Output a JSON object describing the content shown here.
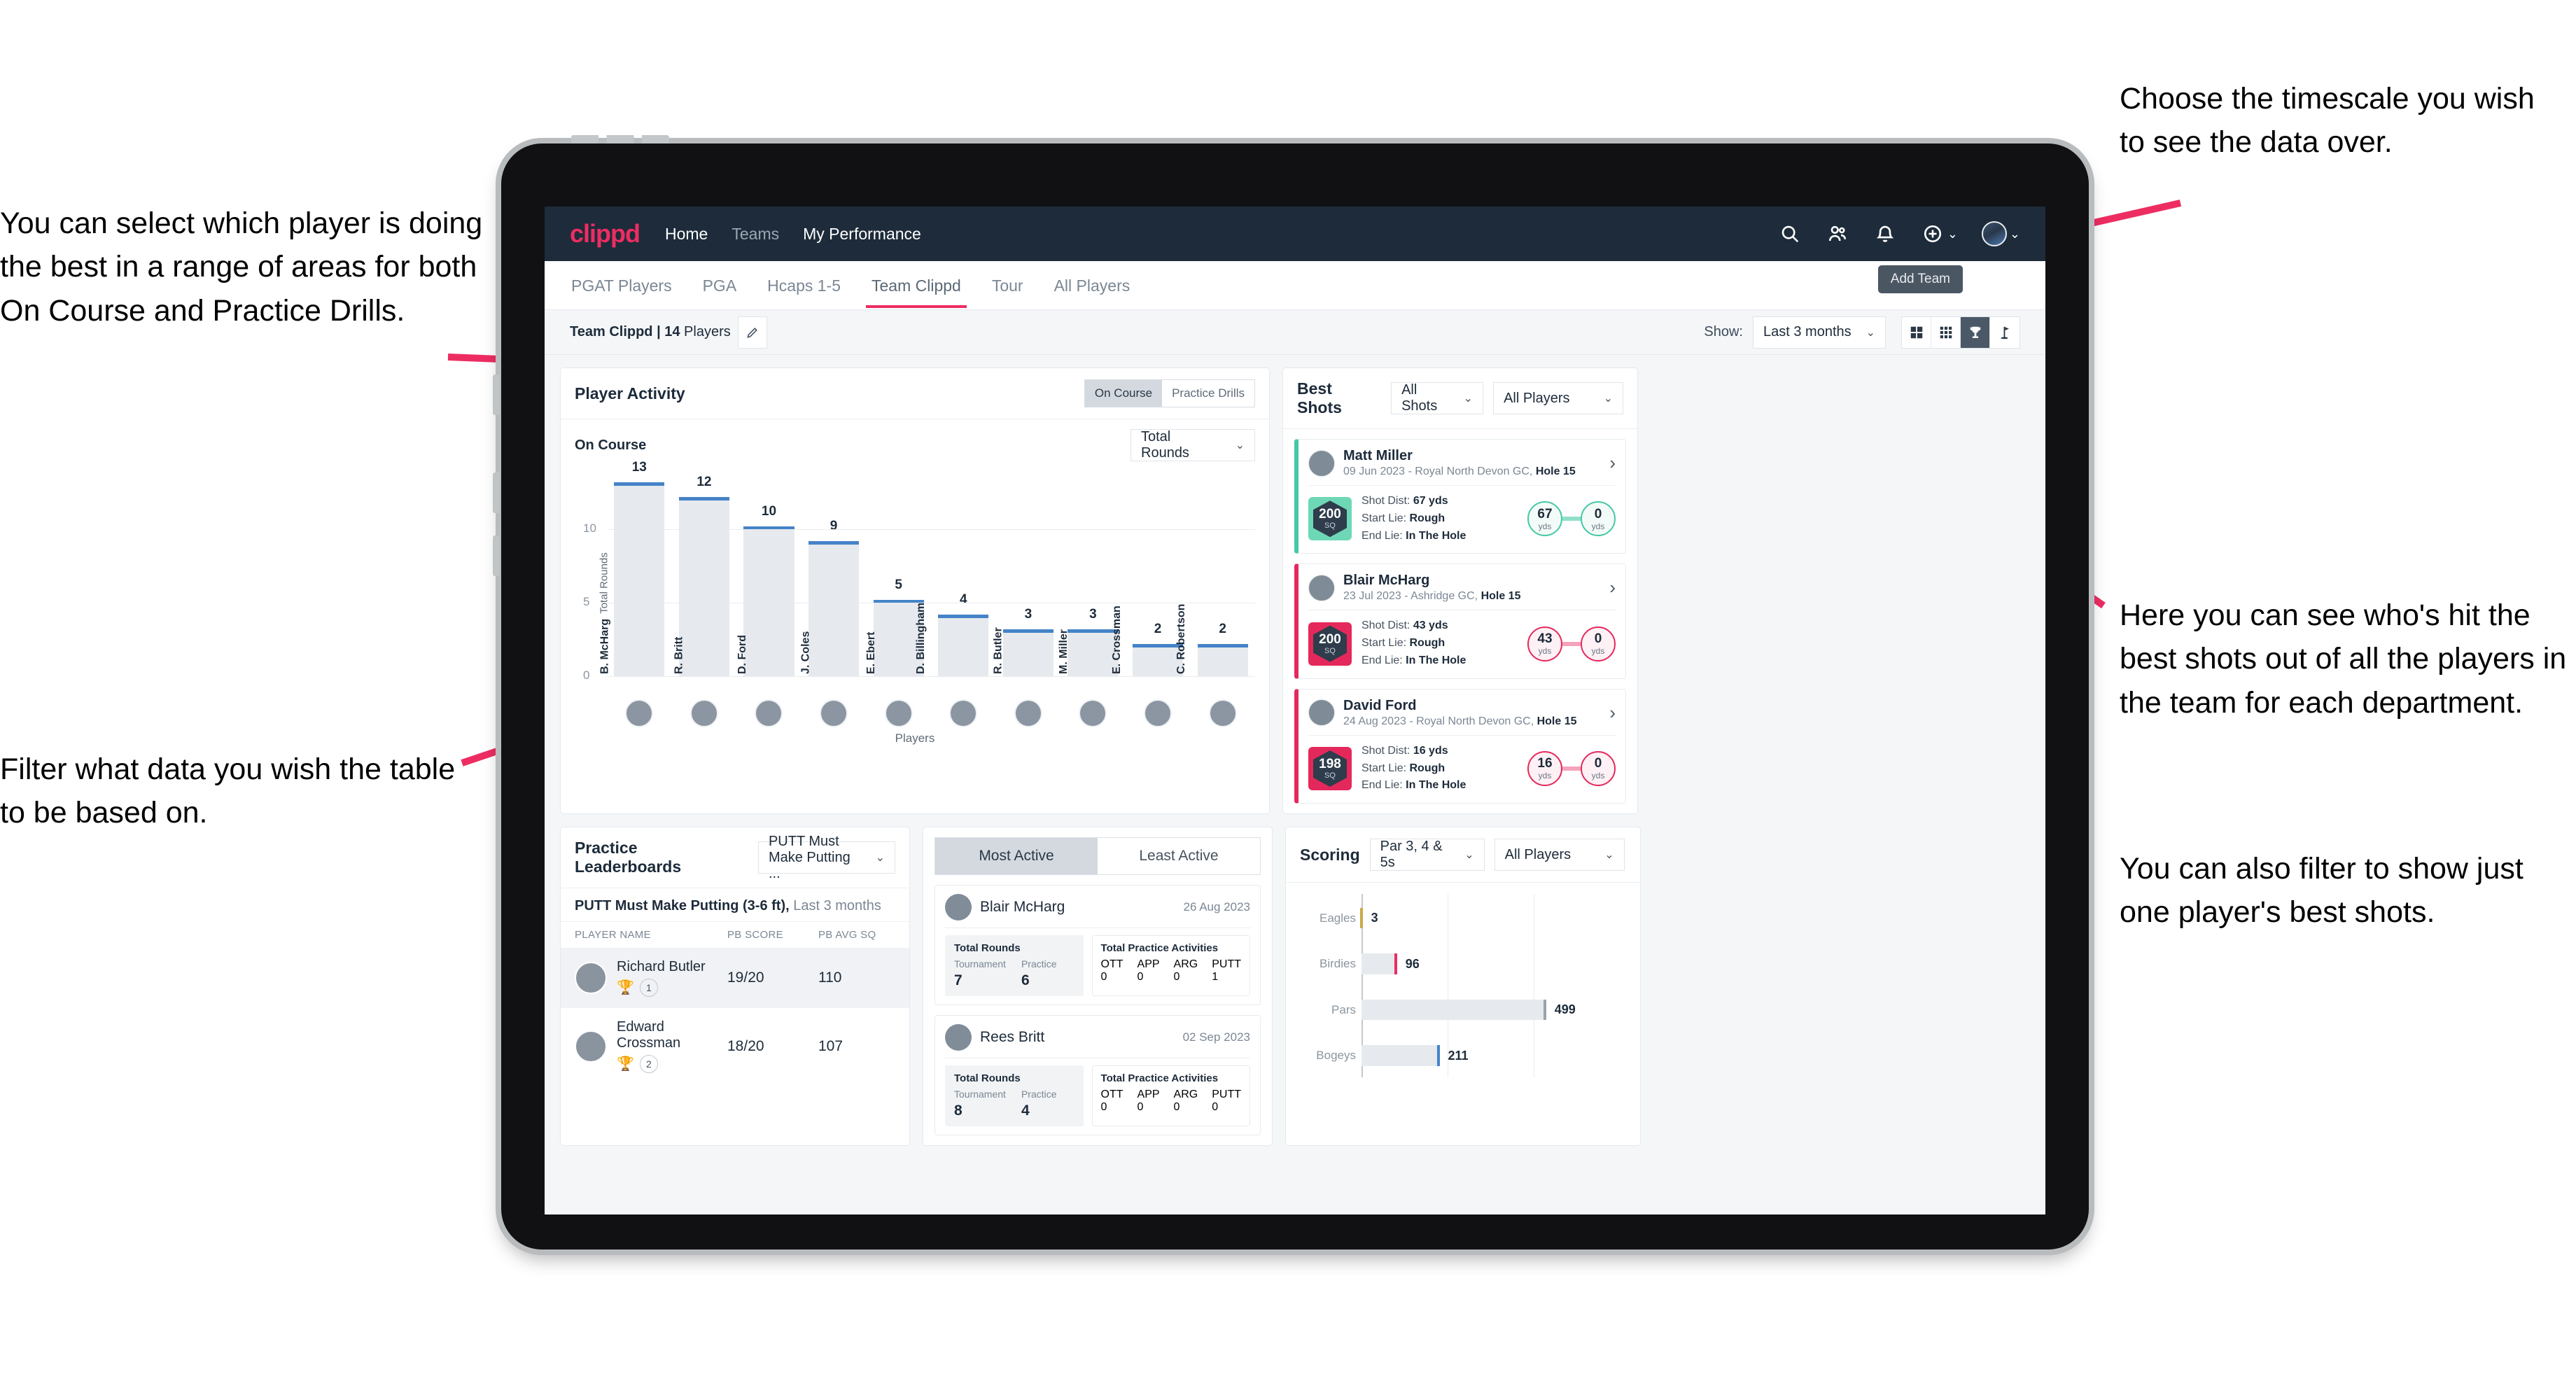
{
  "annotations": {
    "left_top": "You can select which player is doing the best in a range of areas for both On Course and Practice Drills.",
    "left_bottom": "Filter what data you wish the table to be based on.",
    "right_top": "Choose the timescale you wish to see the data over.",
    "right_middle": "Here you can see who's hit the best shots out of all the players in the team for each department.",
    "right_bottom": "You can also filter to show just one player's best shots."
  },
  "topnav": {
    "brand": "clippd",
    "links": [
      {
        "label": "Home",
        "active": true
      },
      {
        "label": "Teams",
        "active": false
      },
      {
        "label": "My Performance",
        "active": true
      }
    ],
    "icons": [
      "search-icon",
      "people-icon",
      "bell-icon",
      "plus-circle-icon",
      "avatar"
    ]
  },
  "tabs": {
    "items": [
      {
        "label": "PGAT Players",
        "active": false
      },
      {
        "label": "PGA",
        "active": false
      },
      {
        "label": "Hcaps 1-5",
        "active": false
      },
      {
        "label": "Team Clippd",
        "active": true
      },
      {
        "label": "Tour",
        "active": false
      },
      {
        "label": "All Players",
        "active": false
      }
    ],
    "add_team_tooltip": "Add Team"
  },
  "filterbar": {
    "team_label_bold": "Team Clippd | 14",
    "team_label_rest": " Players",
    "show_label": "Show:",
    "timescale": "Last 3 months",
    "view_toggles": [
      {
        "name": "grid-large-icon",
        "active": false
      },
      {
        "name": "grid-small-icon",
        "active": false
      },
      {
        "name": "trophy-icon",
        "active": true
      },
      {
        "name": "golf-flag-icon",
        "active": false
      }
    ]
  },
  "player_activity": {
    "title": "Player Activity",
    "segments": [
      {
        "label": "On Course",
        "active": true
      },
      {
        "label": "Practice Drills",
        "active": false
      }
    ],
    "subtitle": "On Course",
    "metric": "Total Rounds"
  },
  "best_shots": {
    "title": "Best Shots",
    "shot_filter": "All Shots",
    "player_filter": "All Players",
    "cards": [
      {
        "name": "Matt Miller",
        "meta_plain": "09 Jun 2023 - Royal North Devon GC, ",
        "meta_bold": "Hole 15",
        "sq": "200",
        "sq_unit": "SQ",
        "shot_dist_label": "Shot Dist: ",
        "shot_dist": "67 yds",
        "start_lie_label": "Start Lie: ",
        "start_lie": "Rough",
        "end_lie_label": "End Lie: ",
        "end_lie": "In The Hole",
        "from_value": "67",
        "from_unit": "yds",
        "to_value": "0",
        "to_unit": "yds",
        "accent": "#45c8a6"
      },
      {
        "name": "Blair McHarg",
        "meta_plain": "23 Jul 2023 - Ashridge GC, ",
        "meta_bold": "Hole 15",
        "sq": "200",
        "sq_unit": "SQ",
        "shot_dist_label": "Shot Dist: ",
        "shot_dist": "43 yds",
        "start_lie_label": "Start Lie: ",
        "start_lie": "Rough",
        "end_lie_label": "End Lie: ",
        "end_lie": "In The Hole",
        "from_value": "43",
        "from_unit": "yds",
        "to_value": "0",
        "to_unit": "yds",
        "accent": "#e5285b"
      },
      {
        "name": "David Ford",
        "meta_plain": "24 Aug 2023 - Royal North Devon GC, ",
        "meta_bold": "Hole 15",
        "sq": "198",
        "sq_unit": "SQ",
        "shot_dist_label": "Shot Dist: ",
        "shot_dist": "16 yds",
        "start_lie_label": "Start Lie: ",
        "start_lie": "Rough",
        "end_lie_label": "End Lie: ",
        "end_lie": "In The Hole",
        "from_value": "16",
        "from_unit": "yds",
        "to_value": "0",
        "to_unit": "yds",
        "accent": "#e5285b"
      }
    ]
  },
  "practice_leaderboards": {
    "title": "Practice Leaderboards",
    "drill_select": "PUTT Must Make Putting ...",
    "subtitle_bold": "PUTT Must Make Putting (3-6 ft),",
    "subtitle_rest": " Last 3 months",
    "columns": [
      "PLAYER NAME",
      "PB SCORE",
      "PB AVG SQ"
    ],
    "rows": [
      {
        "name": "Richard Butler",
        "rank": "1",
        "trophy": "gold",
        "pb_score": "19/20",
        "pb_avg_sq": "110",
        "highlight": true
      },
      {
        "name": "Edward Crossman",
        "rank": "2",
        "trophy": "silver",
        "pb_score": "18/20",
        "pb_avg_sq": "107",
        "highlight": false
      }
    ]
  },
  "activity": {
    "tabs": [
      {
        "label": "Most Active",
        "active": true
      },
      {
        "label": "Least Active",
        "active": false
      }
    ],
    "rounds_label": "Total Rounds",
    "practice_label": "Total Practice Activities",
    "rounds_keys": [
      "Tournament",
      "Practice"
    ],
    "practice_keys": [
      "OTT",
      "APP",
      "ARG",
      "PUTT"
    ],
    "cards": [
      {
        "name": "Blair McHarg",
        "date": "26 Aug 2023",
        "rounds": [
          "7",
          "6"
        ],
        "practice": [
          "0",
          "0",
          "0",
          "1"
        ]
      },
      {
        "name": "Rees Britt",
        "date": "02 Sep 2023",
        "rounds": [
          "8",
          "4"
        ],
        "practice": [
          "0",
          "0",
          "0",
          "0"
        ]
      }
    ]
  },
  "scoring": {
    "title": "Scoring",
    "par_filter": "Par 3, 4 & 5s",
    "player_filter": "All Players"
  },
  "chart_data": [
    {
      "type": "bar",
      "title": "Player Activity",
      "xlabel": "Players",
      "ylabel": "Total Rounds",
      "ylim": [
        0,
        14
      ],
      "yticks": [
        0,
        5,
        10
      ],
      "grid": true,
      "categories": [
        "B. McHarg",
        "R. Britt",
        "D. Ford",
        "J. Coles",
        "E. Ebert",
        "D. Billingham",
        "R. Butler",
        "M. Miller",
        "E. Crossman",
        "C. Robertson"
      ],
      "values": [
        13,
        12,
        10,
        9,
        5,
        4,
        3,
        3,
        2,
        2
      ],
      "bar_color": "#e6e9ed",
      "cap_color": "#4583c8"
    },
    {
      "type": "bar",
      "orientation": "horizontal",
      "title": "Scoring",
      "xlabel": "",
      "ylabel": "",
      "xlim": [
        0,
        700
      ],
      "grid": true,
      "categories": [
        "Eagles",
        "Birdies",
        "Pars",
        "Bogeys"
      ],
      "values": [
        3,
        96,
        499,
        211
      ],
      "tip_colors": [
        "#c8a94b",
        "#ed2d62",
        "#9aa3ab",
        "#4583c8"
      ],
      "bar_color": "#e6e9ed"
    }
  ]
}
